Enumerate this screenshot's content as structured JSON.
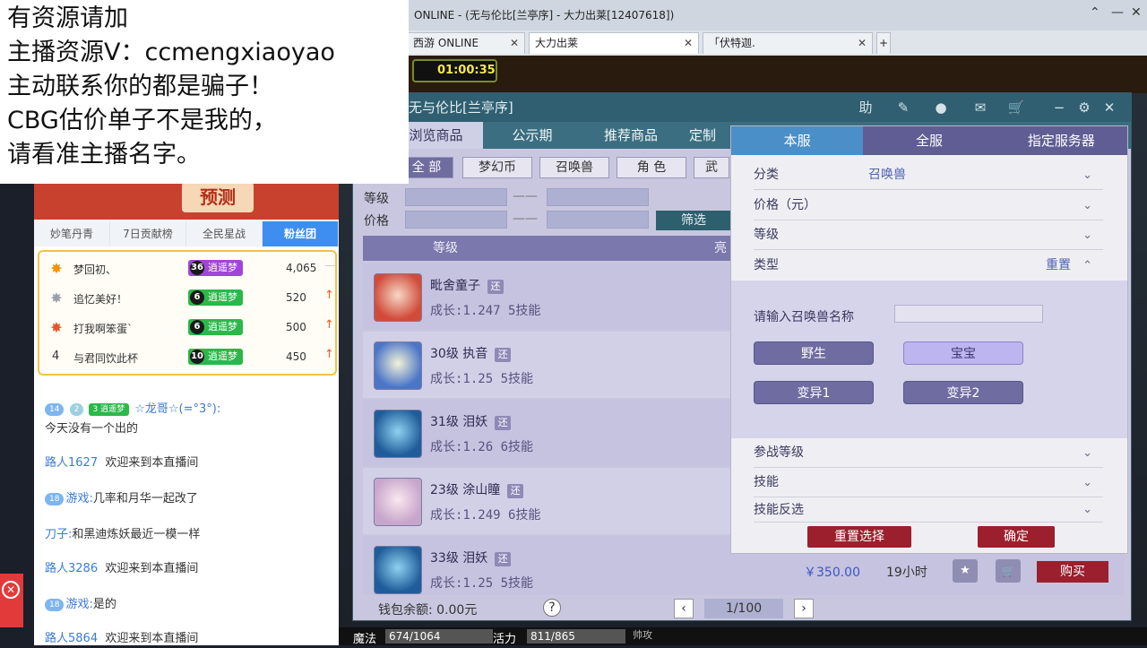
{
  "overlay": {
    "lines": [
      "有资源请加",
      "主播资源V：ccmengxiaoyao",
      "主动联系你的都是骗子！",
      "CBG估价单子不是我的，",
      "请看准主播名字。"
    ]
  },
  "stream": {
    "banner_text": "预测",
    "tabs": [
      "妙笔丹青",
      "7日贡献榜",
      "全民星战",
      "粉丝团"
    ],
    "ranking": [
      {
        "rank": "",
        "name": "梦回初、",
        "level": "36",
        "group": "逍遥梦",
        "score": "4,065"
      },
      {
        "rank": "",
        "name": "追忆美好！",
        "level": "6",
        "group": "逍遥梦",
        "score": "520"
      },
      {
        "rank": "",
        "name": "打我啊笨蛋`",
        "level": "6",
        "group": "逍遥梦",
        "score": "500"
      },
      {
        "rank": "4",
        "name": "与君同饮此杯",
        "level": "10",
        "group": "逍遥梦",
        "score": "450"
      }
    ],
    "chat": [
      {
        "prefix": "14",
        "prefix2": "2",
        "badge": "3",
        "group": "逍遥梦",
        "nick": "☆龙哥☆(=°3°):",
        "text": ""
      },
      {
        "nick": "",
        "text": "今天没有一个出的"
      },
      {
        "nick": "路人1627",
        "text": "欢迎来到本直播间"
      },
      {
        "nick": "游戏:",
        "text": "几率和月华一起改了"
      },
      {
        "nick": "刀子:",
        "text": "和黑迪炼妖最近一模一样"
      },
      {
        "nick": "路人3286",
        "text": "欢迎来到本直播间"
      },
      {
        "nick": "游戏:",
        "text": "是的"
      },
      {
        "nick": "路人5864",
        "text": "欢迎来到本直播间"
      }
    ]
  },
  "browser": {
    "title": "ONLINE - (无与伦比[兰亭序] - 大力出莱[12407618])",
    "tabs": [
      "西游 ONLINE",
      "大力出莱",
      "「伏特迦."
    ],
    "timer": "01:00:35"
  },
  "trade": {
    "title": "无与伦比[兰亭序]",
    "nav": [
      "浏览商品",
      "公示期",
      "推荐商品",
      "定制"
    ],
    "categories": [
      "全 部",
      "梦幻币",
      "召唤兽",
      "角 色",
      "武"
    ],
    "filter_labels": {
      "level": "等级",
      "price": "价格",
      "dash": "——"
    },
    "filter_button": "筛选",
    "list_head": {
      "col1": "等级",
      "col2": "亮"
    },
    "items": [
      {
        "name": "毗舍童子",
        "tag": "还",
        "growth": "成长:1.247 5技能"
      },
      {
        "name": "30级 执音",
        "tag": "还",
        "growth": "成长:1.25 5技能"
      },
      {
        "name": "31级 泪妖",
        "tag": "还",
        "growth": "成长:1.26 6技能"
      },
      {
        "name": "23级 涂山瞳",
        "tag": "还",
        "growth": "成长:1.249 6技能"
      },
      {
        "name": "33级 泪妖",
        "tag": "还",
        "growth": "成长:1.25 5技能",
        "price": "￥350.00",
        "time": "19小时",
        "buy": "购买"
      }
    ],
    "wallet": "钱包余额: 0.00元",
    "page": "1/100"
  },
  "selector": {
    "tabs": [
      "本服",
      "全服",
      "指定服务器"
    ],
    "rows": [
      {
        "label": "分类",
        "value": "召唤兽"
      },
      {
        "label": "价格（元）",
        "value": ""
      },
      {
        "label": "等级",
        "value": ""
      },
      {
        "label": "类型",
        "value": "",
        "reset": "重置"
      }
    ],
    "name_label": "请输入召唤兽名称",
    "types": [
      "野生",
      "宝宝",
      "变异1",
      "变异2"
    ],
    "rows2": [
      "参战等级",
      "技能",
      "技能反选"
    ],
    "reset_btn": "重置选择",
    "ok_btn": "确定"
  },
  "status": {
    "mp_label": "魔法",
    "mp_value": "674/1064",
    "vit_label": "活力",
    "vit_value": "811/865",
    "extra": "帅攻"
  },
  "colors": {
    "accent": "#3d8ef0",
    "trade_head": "#2f5f71",
    "buy": "#9b1f2c"
  }
}
